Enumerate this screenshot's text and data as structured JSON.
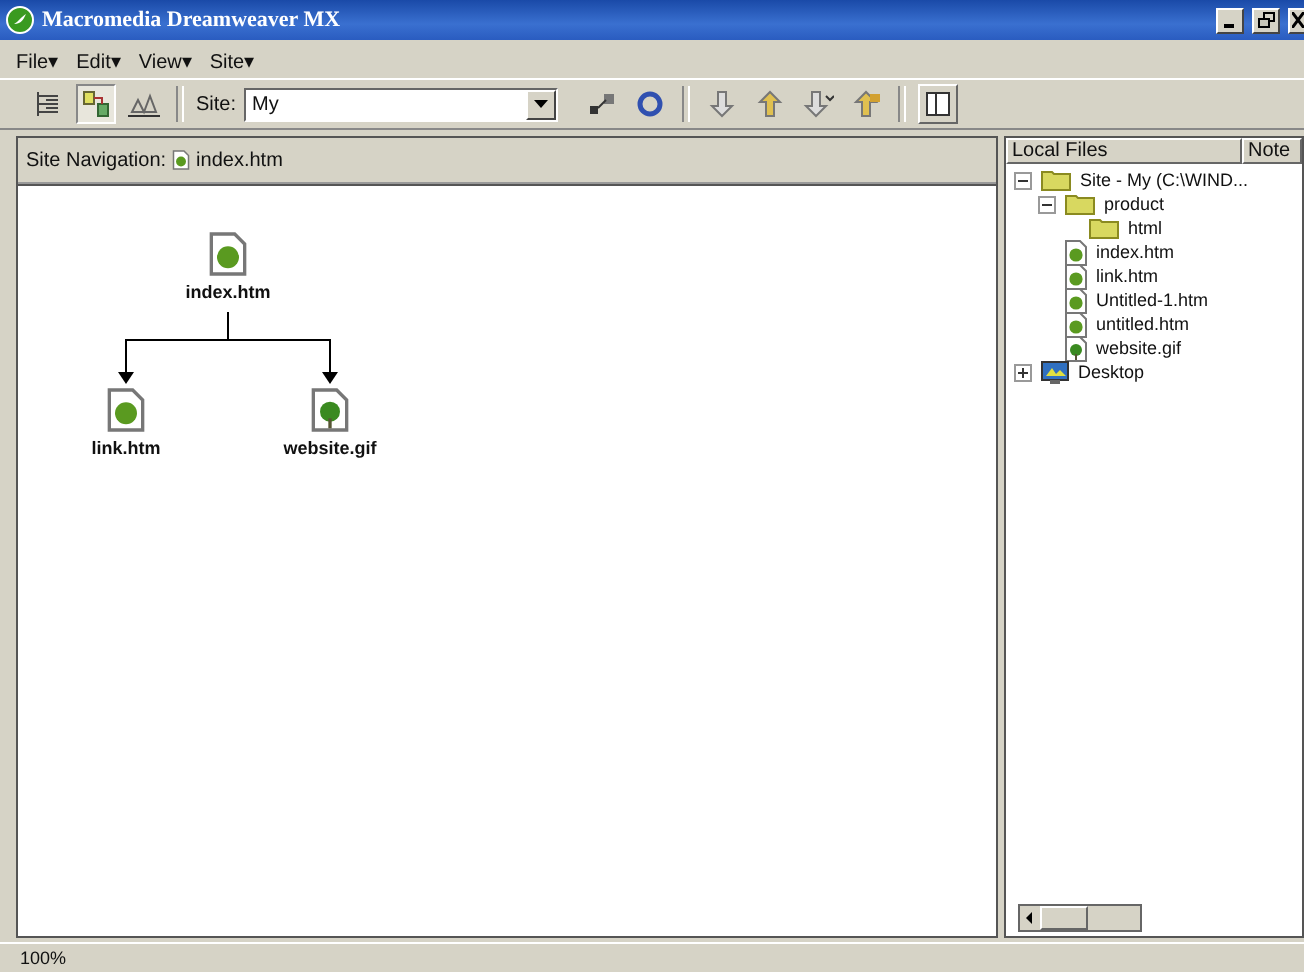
{
  "window": {
    "title": "Macromedia Dreamweaver MX"
  },
  "menu": [
    "File▾",
    "Edit▾",
    "View▾",
    "Site▾"
  ],
  "toolbar": {
    "site_label": "Site:",
    "site_value": "My"
  },
  "navigation": {
    "label": "Site Navigation:",
    "page": "index.htm"
  },
  "site_map": {
    "root": {
      "name": "index.htm",
      "kind": "page",
      "children": [
        {
          "name": "link.htm",
          "kind": "page"
        },
        {
          "name": "website.gif",
          "kind": "image"
        }
      ]
    }
  },
  "file_panel": {
    "columns": [
      "Local Files",
      "Note"
    ],
    "tree": [
      {
        "name": "Site - My (C:\\WIND...",
        "kind": "site",
        "expanded": true,
        "children": [
          {
            "name": "product",
            "kind": "folder",
            "expanded": true,
            "children": [
              {
                "name": "html",
                "kind": "folder"
              }
            ]
          },
          {
            "name": "index.htm",
            "kind": "page"
          },
          {
            "name": "link.htm",
            "kind": "page"
          },
          {
            "name": "Untitled-1.htm",
            "kind": "page"
          },
          {
            "name": "untitled.htm",
            "kind": "page"
          },
          {
            "name": "website.gif",
            "kind": "image"
          }
        ]
      },
      {
        "name": "Desktop",
        "kind": "desktop",
        "expanded": false
      }
    ]
  },
  "status_bar": {
    "zoom": "100%"
  }
}
